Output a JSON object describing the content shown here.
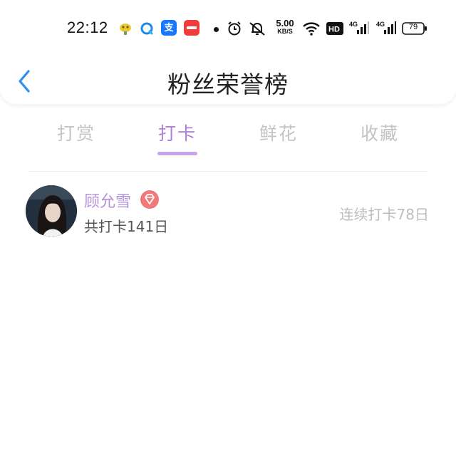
{
  "status_bar": {
    "time": "22:12",
    "network_speed_value": "5.00",
    "network_speed_unit": "KB/S",
    "signal1_label": "4G",
    "signal2_label": "4G",
    "hd_label": "HD",
    "battery_level": "79"
  },
  "header": {
    "title": "粉丝荣誉榜"
  },
  "tabs": [
    {
      "label": "打赏",
      "active": false
    },
    {
      "label": "打卡",
      "active": true
    },
    {
      "label": "鲜花",
      "active": false
    },
    {
      "label": "收藏",
      "active": false
    }
  ],
  "list": [
    {
      "name": "顾允雪",
      "total_text": "共打卡141日",
      "streak_text": "连续打卡78日",
      "badge_icon": "diamond-badge-icon"
    }
  ],
  "colors": {
    "accent": "#b07ed8",
    "underline": "#c7a3ec",
    "back_arrow": "#2d8ff0",
    "badge": "#f07a7a"
  }
}
